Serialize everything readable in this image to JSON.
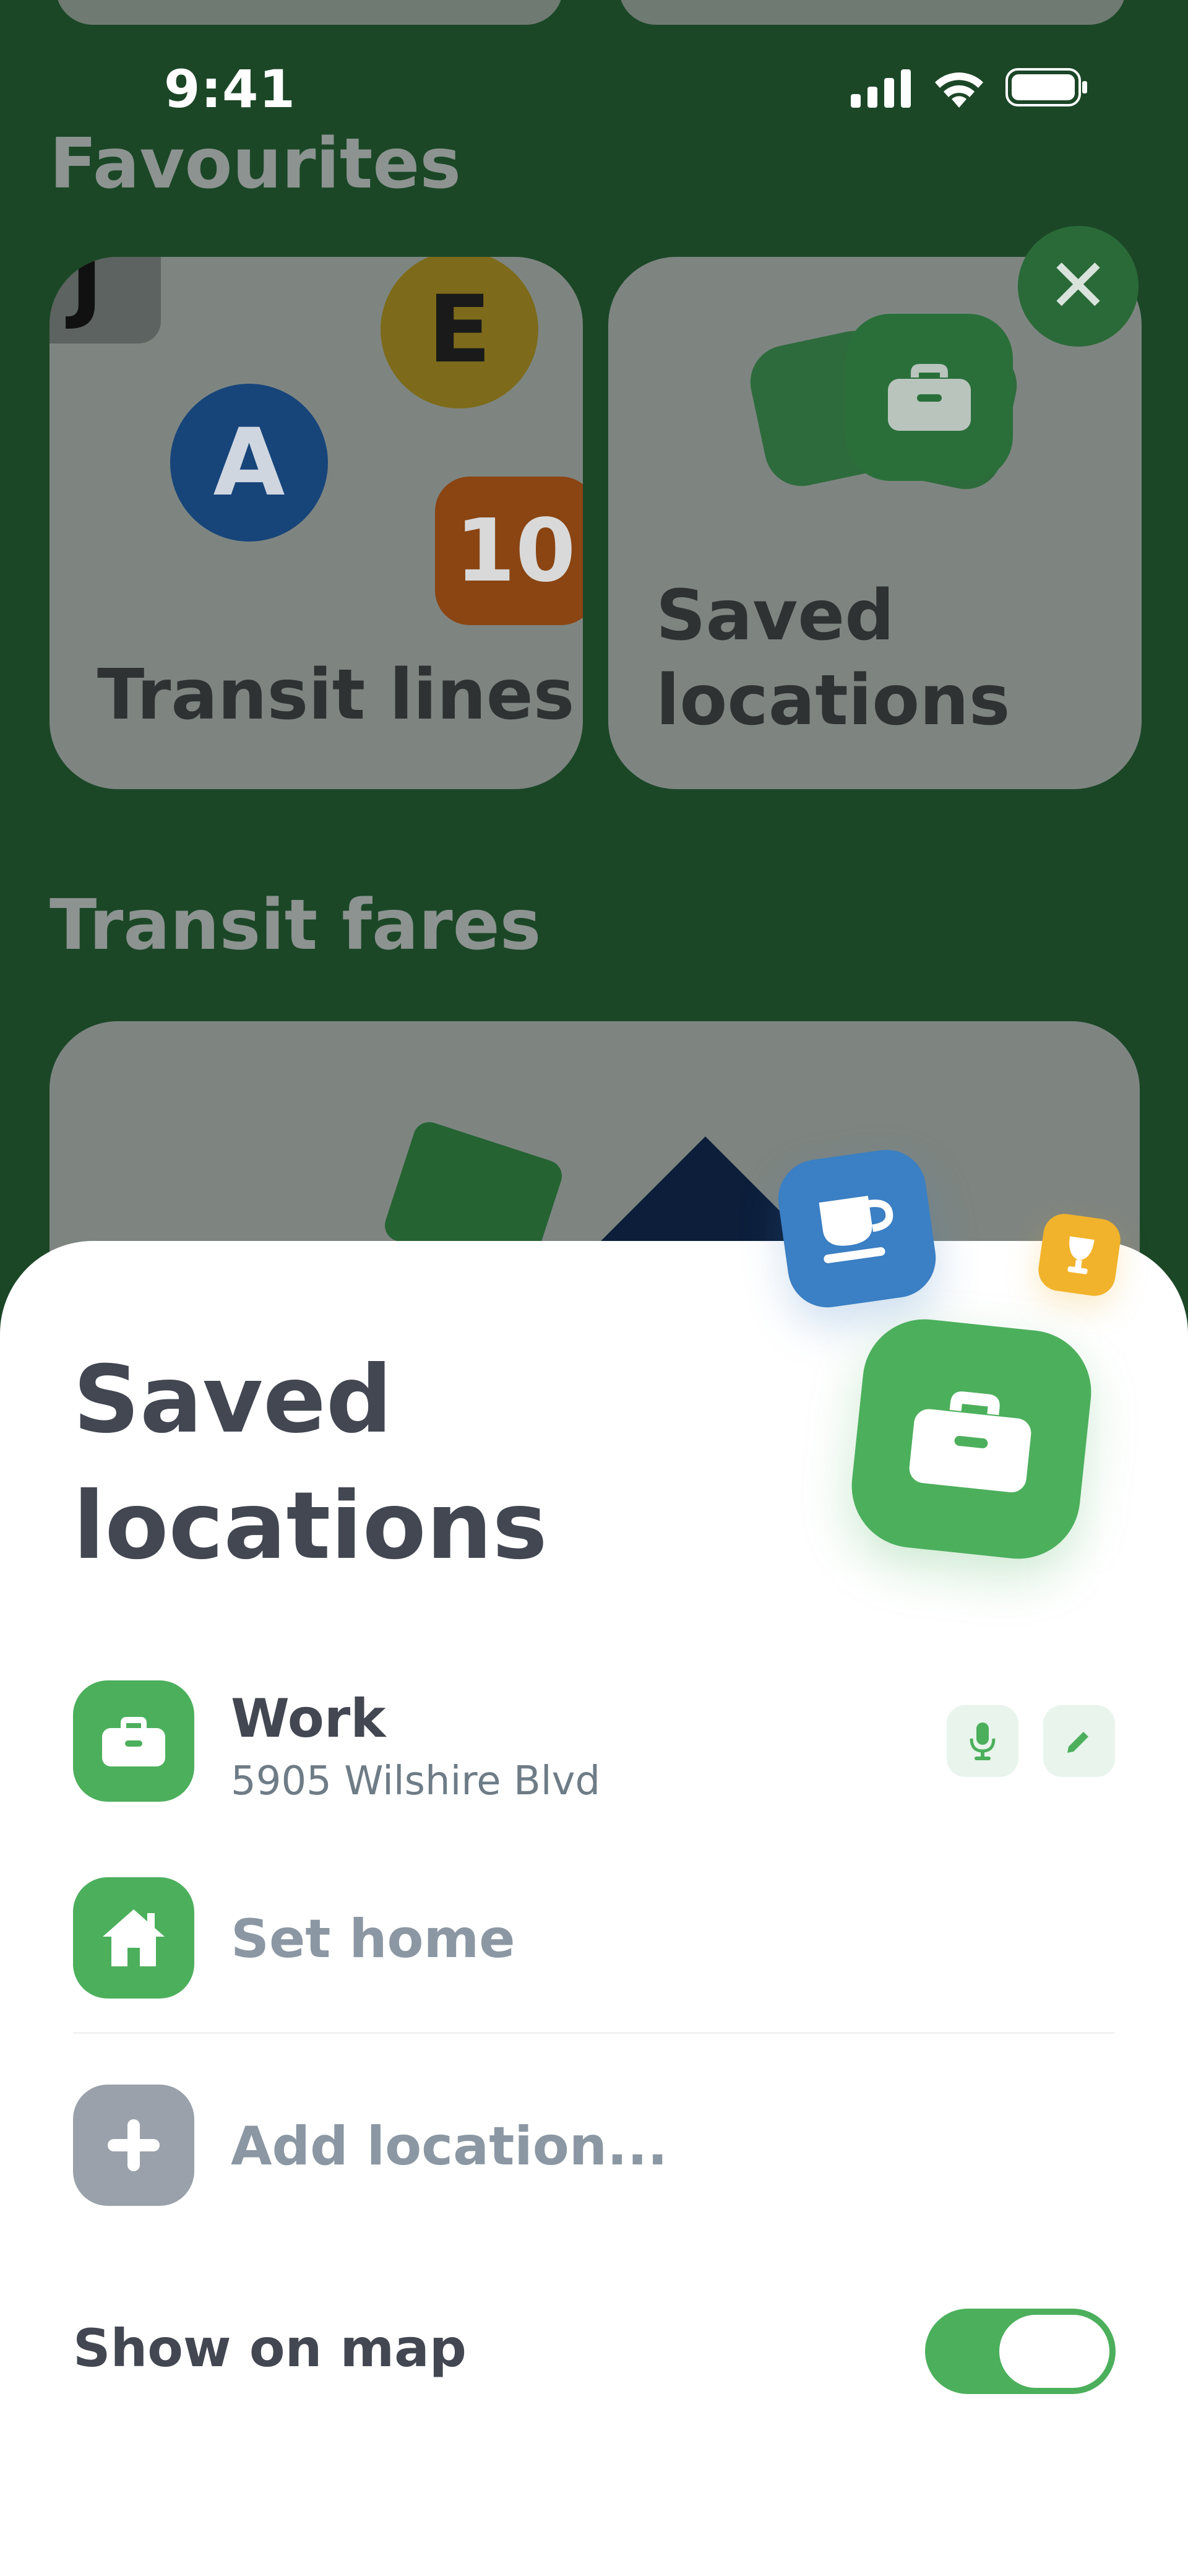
{
  "status_bar": {
    "time": "9:41"
  },
  "favourites": {
    "title": "Favourites",
    "cards": [
      {
        "label": "Transit lines",
        "badges": [
          "J",
          "E",
          "A",
          "10"
        ]
      },
      {
        "label": "Saved locations"
      }
    ]
  },
  "transit_fares": {
    "title": "Transit fares"
  },
  "sheet": {
    "title": "Saved locations",
    "locations": [
      {
        "name": "Work",
        "address": "5905 Wilshire Blvd",
        "icon": "briefcase-icon"
      }
    ],
    "set_home_label": "Set home",
    "add_location_label": "Add location...",
    "show_on_map": {
      "label": "Show on map",
      "enabled": true
    }
  },
  "colors": {
    "accent": "#4caf5c",
    "background_dim": "#1b4727",
    "text_primary": "#424752",
    "text_muted": "#8b97a2",
    "coffee_blue": "#3b7fc4",
    "trophy_yellow": "#f1b32b"
  }
}
